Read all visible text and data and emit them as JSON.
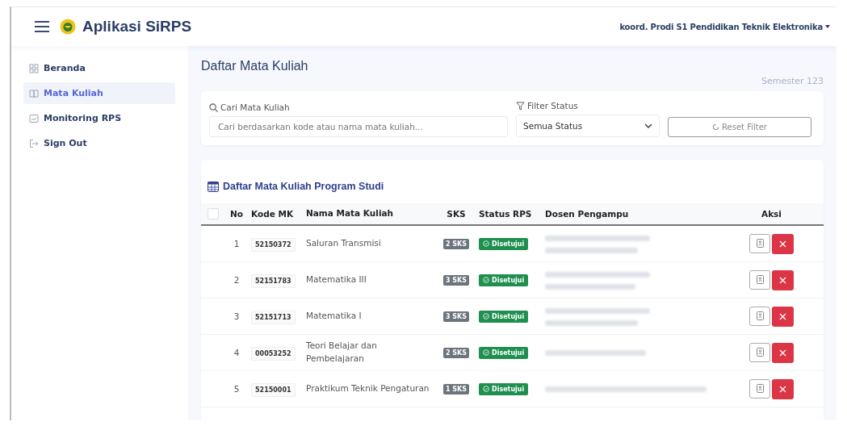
{
  "header": {
    "title": "Aplikasi SiRPS",
    "user_menu": "koord. Prodi S1 Pendidikan Teknik Elektronika"
  },
  "sidebar": {
    "items": [
      {
        "label": "Beranda",
        "selected": false
      },
      {
        "label": "Mata Kuliah",
        "selected": true
      },
      {
        "label": "Monitoring RPS",
        "selected": false
      },
      {
        "label": "Sign Out",
        "selected": false
      }
    ]
  },
  "page": {
    "title": "Daftar Mata Kuliah",
    "semester": "Semester 123"
  },
  "filters": {
    "search_label": "Cari Mata Kuliah",
    "search_placeholder": "Cari berdasarkan kode atau nama mata kuliah...",
    "status_label": "Filter Status",
    "status_value": "Semua Status",
    "reset_button": "Reset Filter"
  },
  "table": {
    "title": "Daftar Mata Kuliah Program Studi",
    "select_all_checked": false,
    "columns": [
      "No",
      "Kode MK",
      "Nama Mata Kuliah",
      "SKS",
      "Status RPS",
      "Dosen Pengampu",
      "Aksi"
    ],
    "rows": [
      {
        "no": "1",
        "kode": "52150372",
        "nama": "Saluran Transmisi",
        "sks": "2 SKS",
        "status": "Disetujui"
      },
      {
        "no": "2",
        "kode": "52151783",
        "nama": "Matematika III",
        "sks": "3 SKS",
        "status": "Disetujui"
      },
      {
        "no": "3",
        "kode": "52151713",
        "nama": "Matematika I",
        "sks": "3 SKS",
        "status": "Disetujui"
      },
      {
        "no": "4",
        "kode": "00053252",
        "nama": "Teori Belajar dan Pembelajaran",
        "sks": "2 SKS",
        "status": "Disetujui"
      },
      {
        "no": "5",
        "kode": "52150001",
        "nama": "Praktikum Teknik Pengaturan",
        "sks": "1 SKS",
        "status": "Disetujui"
      }
    ]
  }
}
